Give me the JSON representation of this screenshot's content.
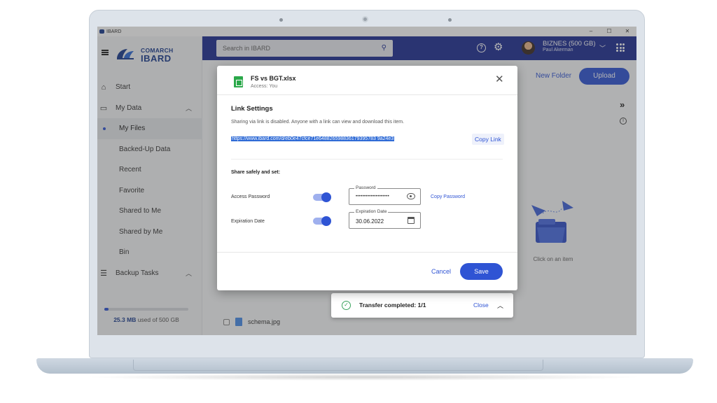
{
  "window": {
    "title": "IBARD",
    "controls": [
      "–",
      "☐",
      "✕"
    ]
  },
  "brand": {
    "line1": "COMARCH",
    "line2": "IBARD"
  },
  "search": {
    "placeholder": "Search in IBARD"
  },
  "account": {
    "plan": "BIZNES (500 GB)",
    "user": "Paul Akerman"
  },
  "nav": {
    "start": "Start",
    "my_data": "My Data",
    "my_files": "My Files",
    "backed_up": "Backed-Up Data",
    "recent": "Recent",
    "favorite": "Favorite",
    "shared_to_me": "Shared to Me",
    "shared_by_me": "Shared by Me",
    "bin": "Bin",
    "backup_tasks": "Backup Tasks"
  },
  "storage": {
    "used": "25.3 MB",
    "rest": "used of 500 GB",
    "used_fraction": 0.05
  },
  "toolbar": {
    "new_folder": "New Folder",
    "upload": "Upload"
  },
  "details": {
    "hint": "Click on an item"
  },
  "files": [
    {
      "name": "schema.jpg"
    }
  ],
  "toast": {
    "text": "Transfer completed: 1/1",
    "close": "Close"
  },
  "dialog": {
    "file_name": "FS vs BGT.xlsx",
    "access": "Access: You",
    "section_title": "Link Settings",
    "description": "Sharing via link is disabled. Anyone with a link can view and download this item.",
    "link": "https://www.ibard.com/d/eb0e47cfce71e648826598836179395783 9a24e3",
    "copy_link": "Copy Link",
    "share_label": "Share safely and set:",
    "access_password_label": "Access Password",
    "password_field_label": "Password",
    "password_value": "••••••••••••••••••••",
    "copy_password": "Copy Password",
    "expiration_label": "Expiration Date",
    "expiration_field_label": "Expiration Date",
    "expiration_value": "30.06.2022",
    "cancel": "Cancel",
    "save": "Save"
  },
  "colors": {
    "primary": "#2f54d4",
    "appbar": "#1f2f93",
    "brand": "#1b3d8f",
    "sheet_icon": "#2ba84a",
    "success": "#3aa35d"
  }
}
